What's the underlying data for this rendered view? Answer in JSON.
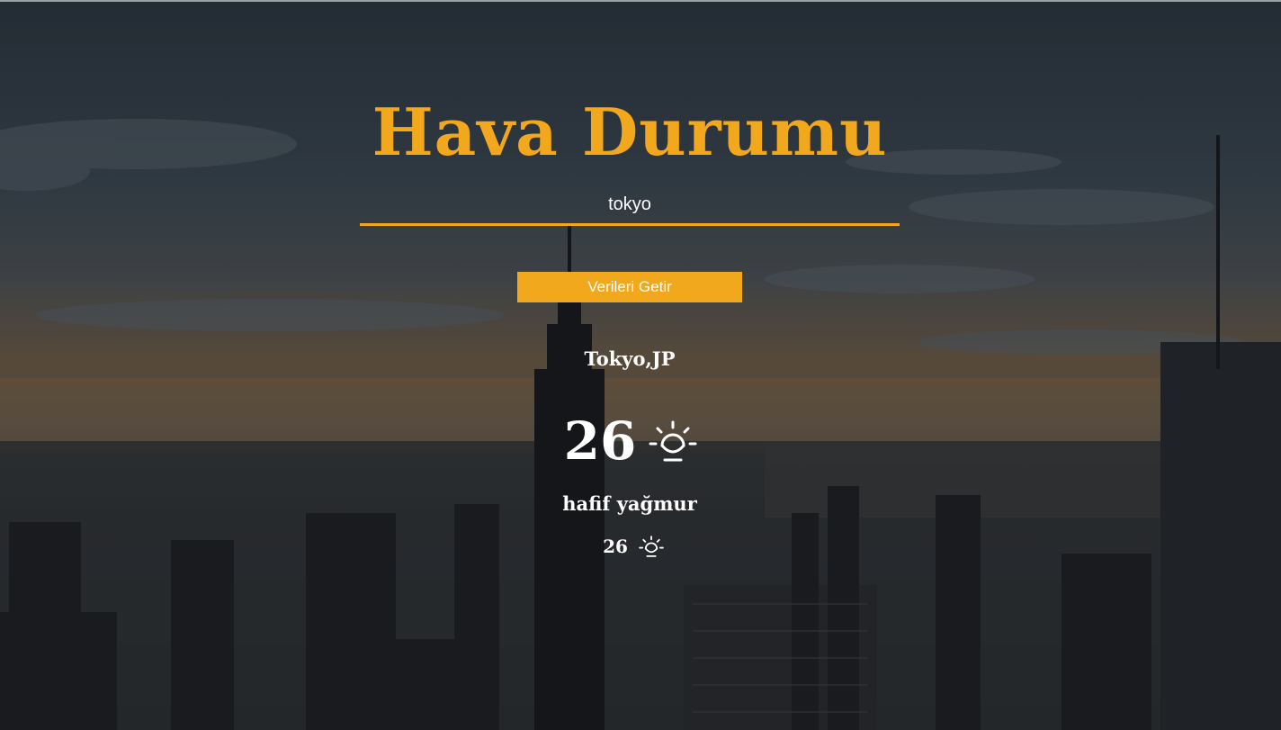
{
  "header": {
    "title": "Hava Durumu"
  },
  "search": {
    "value": "tokyo",
    "placeholder": ""
  },
  "actions": {
    "fetch_label": "Verileri Getir"
  },
  "weather": {
    "location": "Tokyo,JP",
    "temperature": "26",
    "description": "hafif yağmur",
    "secondary_temperature": "26",
    "icon": "sunrise-icon"
  },
  "colors": {
    "accent": "#f2a81d",
    "text": "#ffffff"
  }
}
